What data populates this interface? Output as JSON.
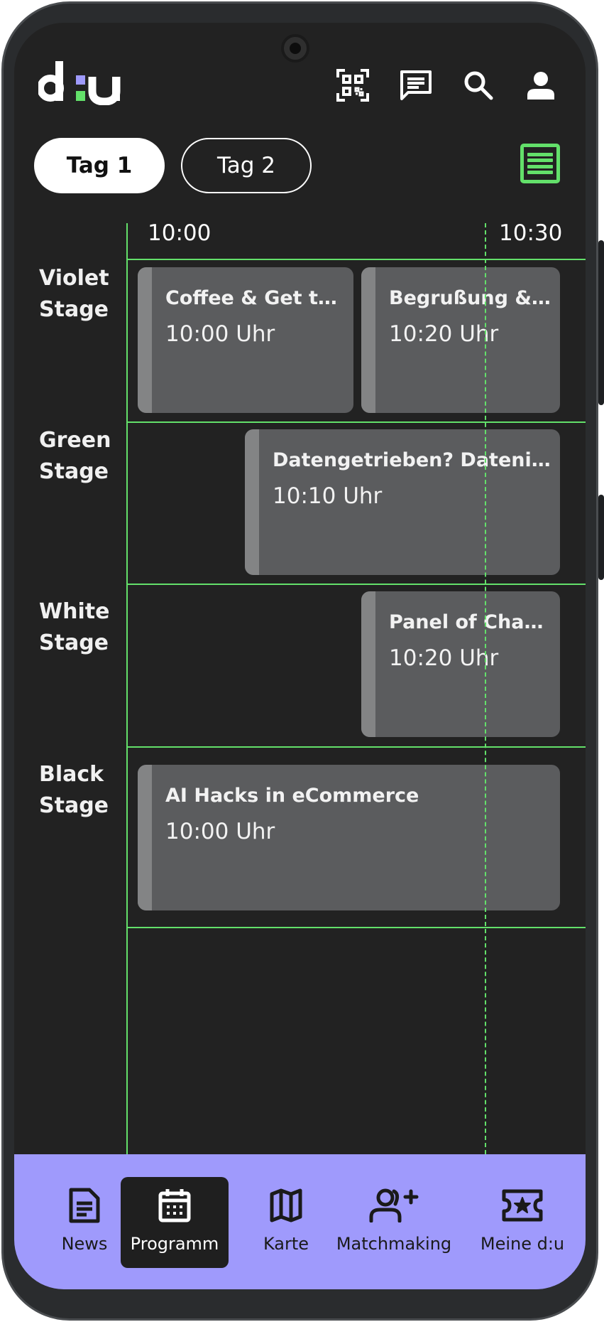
{
  "header": {
    "logo_text": "d:u",
    "icons": [
      "qr-code-icon",
      "chat-icon",
      "search-icon",
      "user-icon"
    ]
  },
  "day_tabs": [
    {
      "label": "Tag 1",
      "active": true
    },
    {
      "label": "Tag 2",
      "active": false
    }
  ],
  "schedule": {
    "time_labels": [
      "10:00",
      "10:30"
    ],
    "stages": [
      {
        "label": "Violet\nStage"
      },
      {
        "label": "Green\nStage"
      },
      {
        "label": "White\nStage"
      },
      {
        "label": "Black\nStage"
      }
    ],
    "sessions": [
      {
        "title": "Coffee & Get to …",
        "time": "10:00 Uhr",
        "stage": "Violet Stage"
      },
      {
        "title": "Begrußung & E…",
        "time": "10:20 Uhr",
        "stage": "Violet Stage"
      },
      {
        "title": "Datengetrieben? Datenins…",
        "time": "10:10 Uhr",
        "stage": "Green Stage"
      },
      {
        "title": "Panel of Cham …",
        "time": "10:20 Uhr",
        "stage": "White Stage"
      },
      {
        "title": "AI Hacks in eCommerce",
        "time": "10:00 Uhr",
        "stage": "Black Stage"
      }
    ]
  },
  "bottom_nav": [
    {
      "label": "News",
      "icon": "news-icon",
      "active": false
    },
    {
      "label": "Programm",
      "icon": "calendar-icon",
      "active": true
    },
    {
      "label": "Karte",
      "icon": "map-icon",
      "active": false
    },
    {
      "label": "Matchmaking",
      "icon": "add-user-icon",
      "active": false
    },
    {
      "label": "Meine d:u",
      "icon": "ticket-star-icon",
      "active": false
    }
  ],
  "colors": {
    "background": "#222222",
    "accent_green": "#63e06a",
    "nav_background": "#9f9afc",
    "session_card": "#5b5c5e",
    "logo_colon_top": "#9f9afc",
    "logo_colon_bottom": "#63e06a"
  }
}
